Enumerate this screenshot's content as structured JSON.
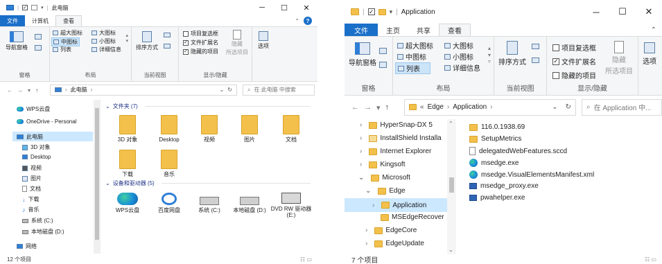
{
  "w1": {
    "title": "此电脑",
    "tabs": [
      "文件",
      "计算机",
      "查看"
    ],
    "ribbon": {
      "pane_label": "导航窗格",
      "pane_group": "窗格",
      "layout": [
        "超大图标",
        "大图标",
        "中图标",
        "小图标",
        "列表",
        "详细信息"
      ],
      "layout_group": "布局",
      "sort_label": "排序方式",
      "view_group": "当前视图",
      "checks": [
        "项目复选框",
        "文件扩展名",
        "隐藏的项目"
      ],
      "hide_label": "隐藏",
      "hide_label2": "所选项目",
      "showhide_group": "显示/隐藏",
      "options": "选项"
    },
    "address": {
      "path": "此电脑",
      "search": "在 此电脑 中搜索"
    },
    "sidebar": [
      "WPS云盘",
      "OneDrive - Personal",
      "此电脑",
      "3D 对象",
      "Desktop",
      "视频",
      "图片",
      "文档",
      "下载",
      "音乐",
      "系统 (C:)",
      "本地磁盘 (D:)",
      "网络"
    ],
    "folders_header": "文件夹 (7)",
    "folders": [
      "3D 对象",
      "Desktop",
      "视频",
      "图片",
      "文档",
      "下载",
      "音乐"
    ],
    "drives_header": "设备和驱动器 (5)",
    "drives": [
      "WPS云盘",
      "百度网盘",
      "系统 (C:)",
      "本地磁盘 (D:)",
      "DVD RW 驱动器 (E:)"
    ],
    "status": "12 个项目"
  },
  "w2": {
    "title": "Application",
    "tabs": [
      "文件",
      "主页",
      "共享",
      "查看"
    ],
    "ribbon": {
      "pane_label": "导航窗格",
      "pane_group": "窗格",
      "layout": [
        "超大图标",
        "大图标",
        "中图标",
        "小图标",
        "列表",
        "详细信息"
      ],
      "layout_group": "布局",
      "sort_label": "排序方式",
      "view_group": "当前视图",
      "checks": [
        "项目复选框",
        "文件扩展名",
        "隐藏的项目"
      ],
      "hide_label": "隐藏",
      "hide_label2": "所选项目",
      "showhide_group": "显示/隐藏",
      "options": "选项"
    },
    "address": {
      "prefix": "«",
      "seg1": "Edge",
      "seg2": "Application",
      "search": "在 Application 中..."
    },
    "tree": [
      "HyperSnap-DX 5",
      "InstallShield Installa",
      "Internet Explorer",
      "Kingsoft",
      "Microsoft",
      "Edge",
      "Application",
      "MSEdgeRecover",
      "EdgeCore",
      "EdgeUpdate"
    ],
    "files": [
      "116.0.1938.69",
      "SetupMetrics",
      "delegatedWebFeatures.sccd",
      "msedge.exe",
      "msedge.VisualElementsManifest.xml",
      "msedge_proxy.exe",
      "pwahelper.exe"
    ],
    "status": "7 个项目"
  },
  "colors": {
    "accent": "#1a6fc9",
    "folder": "#f3c14b",
    "selection": "#cce8ff"
  }
}
